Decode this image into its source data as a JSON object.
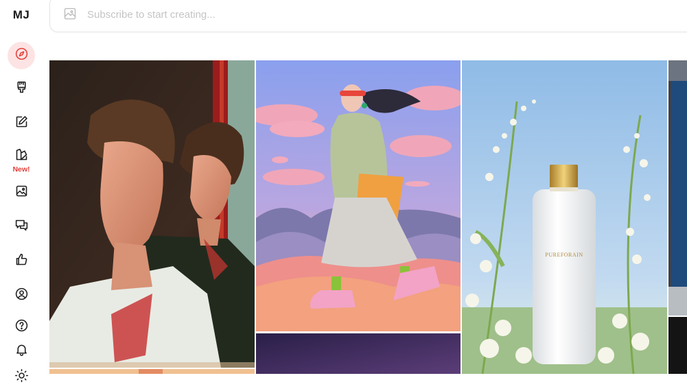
{
  "brand": {
    "logo_text": "MJ"
  },
  "search": {
    "placeholder": "Subscribe to start creating..."
  },
  "sidebar": {
    "items": [
      {
        "name": "explore",
        "icon": "compass-icon",
        "active": true
      },
      {
        "name": "create",
        "icon": "paintbrush-icon"
      },
      {
        "name": "edit",
        "icon": "edit-icon"
      },
      {
        "name": "personalize",
        "icon": "palette-icon",
        "badge": "New!"
      },
      {
        "name": "organize",
        "icon": "image-icon"
      },
      {
        "name": "chat",
        "icon": "chat-bubbles-icon"
      },
      {
        "name": "tasks",
        "icon": "thumbs-up-icon"
      },
      {
        "name": "profile",
        "icon": "user-circle-icon"
      },
      {
        "name": "help",
        "icon": "help-icon"
      },
      {
        "name": "updates",
        "icon": "bell-icon"
      },
      {
        "name": "theme",
        "icon": "sun-icon"
      }
    ]
  },
  "gallery": {
    "images": [
      {
        "subject": "two young men with curly hair, vintage photo",
        "brand_text": ""
      },
      {
        "subject": "stylized woman walking with orange bag, pastel clouds",
        "brand_text": ""
      },
      {
        "subject": "white perfume bottle among white flowers",
        "brand_text": "PUREFORAIN"
      },
      {
        "subject": "partial image of building",
        "brand_text": ""
      },
      {
        "subject": "purple gradient image",
        "brand_text": ""
      }
    ]
  },
  "colors": {
    "accent": "#e2403b",
    "active_bg": "#fde3e3"
  }
}
